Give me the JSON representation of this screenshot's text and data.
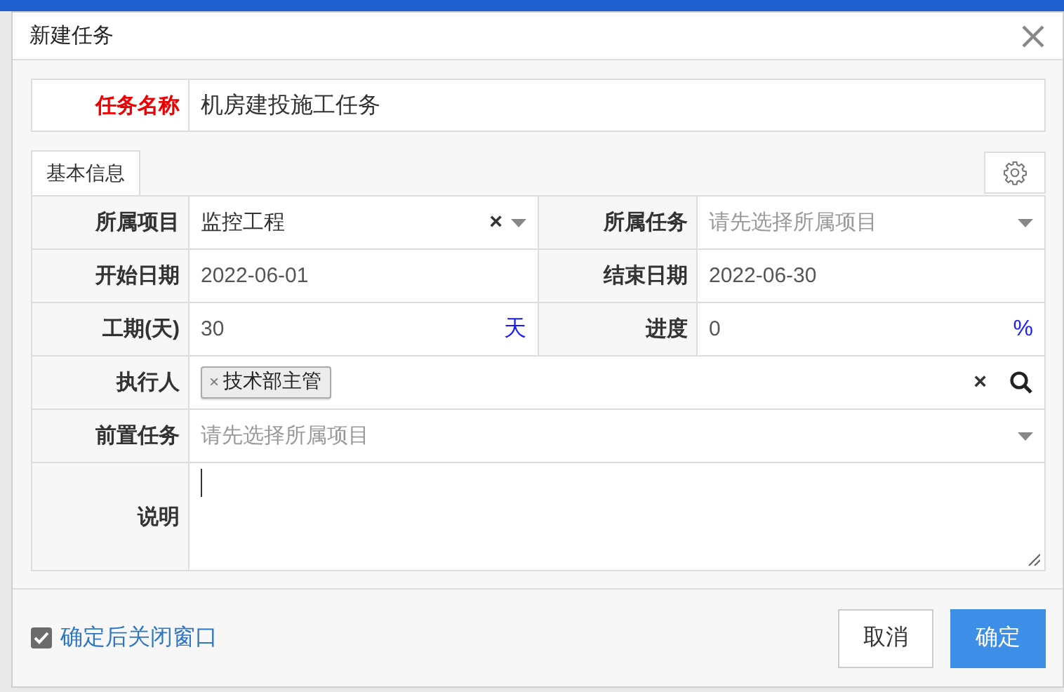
{
  "dialog": {
    "title": "新建任务"
  },
  "name_field": {
    "label": "任务名称",
    "value": "机房建投施工任务",
    "required": true
  },
  "tabs": [
    {
      "label": "基本信息",
      "selected": true
    }
  ],
  "rows": [
    {
      "cells": [
        {
          "label": "所属项目",
          "kind": "select",
          "value": "监控工程",
          "clear": "×"
        },
        {
          "label": "所属任务",
          "kind": "select",
          "placeholder": "请先选择所属项目"
        }
      ]
    },
    {
      "cells": [
        {
          "label": "开始日期",
          "kind": "text",
          "value": "2022-06-01"
        },
        {
          "label": "结束日期",
          "kind": "text",
          "value": "2022-06-30"
        }
      ]
    },
    {
      "cells": [
        {
          "label": "工期(天)",
          "kind": "text",
          "value": "30",
          "unit": "天"
        },
        {
          "label": "进度",
          "kind": "text",
          "value": "0",
          "unit": "%"
        }
      ]
    },
    {
      "cells": [
        {
          "label": "执行人",
          "kind": "tags",
          "tags": [
            {
              "remove": "×",
              "label": "技术部主管"
            }
          ],
          "clear": "×"
        }
      ]
    },
    {
      "cells": [
        {
          "label": "前置任务",
          "kind": "select",
          "placeholder": "请先选择所属项目"
        }
      ]
    },
    {
      "cells": [
        {
          "label": "说明",
          "kind": "textarea"
        }
      ]
    }
  ],
  "footer": {
    "close_after_confirm": {
      "label": "确定后关闭窗口",
      "checked": true
    },
    "buttons": [
      {
        "label": "取消",
        "kind": "default"
      },
      {
        "label": "确定",
        "kind": "primary"
      }
    ]
  }
}
